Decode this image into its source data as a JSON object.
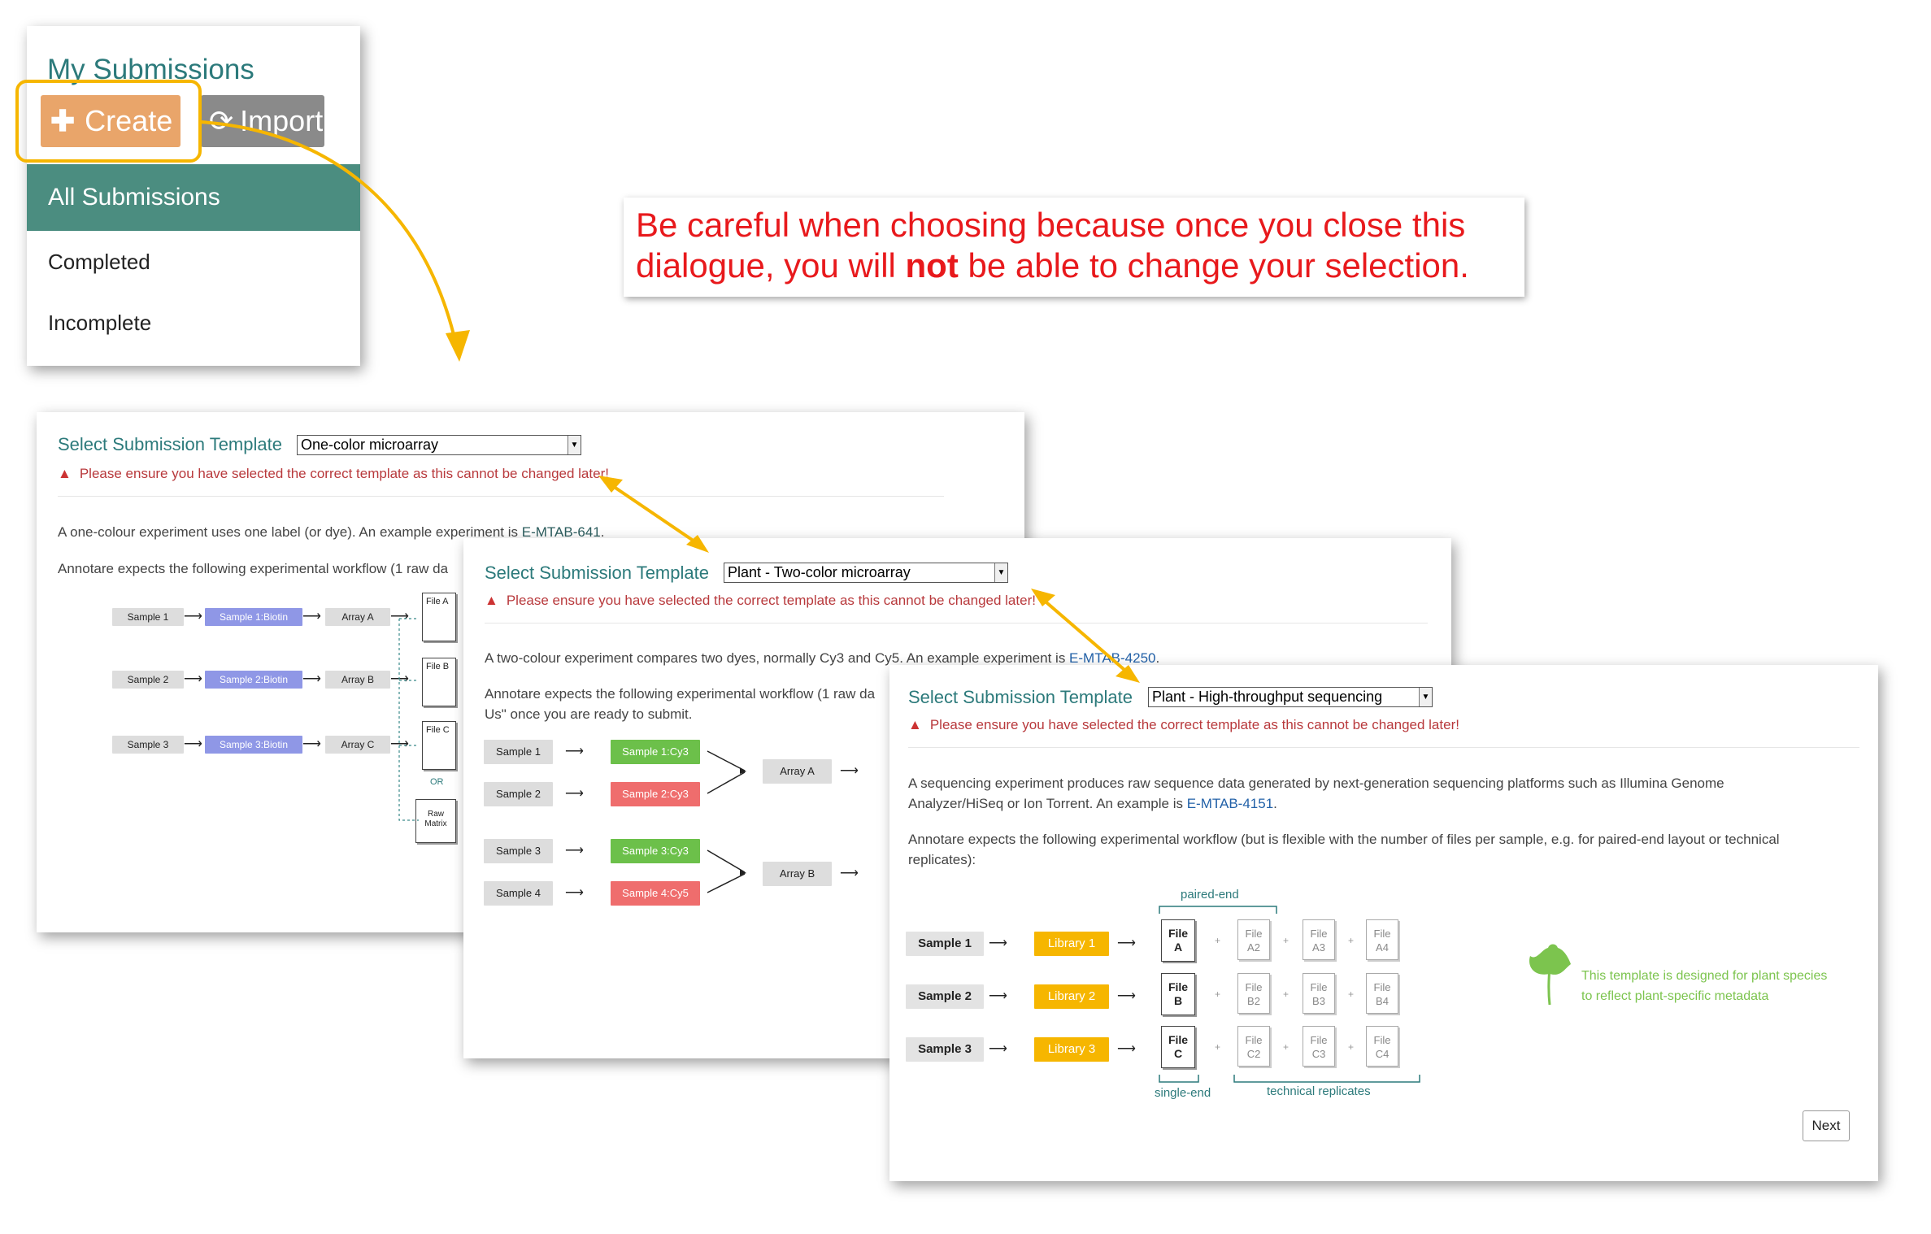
{
  "submissions": {
    "title": "My Submissions",
    "create_label": "Create",
    "import_label": "Import",
    "all_label": "All Submissions",
    "completed_label": "Completed",
    "incomplete_label": "Incomplete"
  },
  "note": {
    "line1": "Be careful when choosing because once you close this",
    "line2_pre": "dialogue,  you will ",
    "line2_bold": "not",
    "line2_post": " be able to change your selection."
  },
  "warning": "Please ensure you have selected the correct template as this cannot be changed later!",
  "template_label": "Select Submission Template",
  "dialog1": {
    "selected": "One-color microarray",
    "desc_pre": "A one-colour experiment uses one label (or dye). An example experiment is ",
    "desc_link": "E-MTAB-641",
    "desc_post": ".",
    "workflow": "Annotare expects the following experimental workflow (1 raw da",
    "samples": [
      "Sample 1",
      "Sample 2",
      "Sample 3"
    ],
    "labels": [
      "Sample 1:Biotin",
      "Sample 2:Biotin",
      "Sample 3:Biotin"
    ],
    "arrays": [
      "Array A",
      "Array B",
      "Array C"
    ],
    "files": [
      "File A",
      "File B",
      "File C"
    ],
    "or": "OR",
    "raw": "Raw Matrix"
  },
  "dialog2": {
    "selected": "Plant - Two-color microarray",
    "desc_pre": "A two-colour experiment compares two dyes, normally Cy3 and Cy5. An example experiment is ",
    "desc_link": "E-MTAB-4250",
    "desc_post": ".",
    "workflow1": "Annotare expects the following experimental workflow (1 raw da",
    "workflow2": "Us\" once you are ready to submit.",
    "samples": [
      "Sample 1",
      "Sample 2",
      "Sample 3",
      "Sample 4"
    ],
    "labels": [
      "Sample 1:Cy3",
      "Sample 2:Cy3",
      "Sample 3:Cy3",
      "Sample 4:Cy5"
    ],
    "arrays": [
      "Array A",
      "Array B"
    ]
  },
  "dialog3": {
    "selected": "Plant - High-throughput sequencing",
    "desc1": "A sequencing experiment produces raw sequence data generated by next-generation sequencing platforms such as Illumina Genome",
    "desc2_pre": "Analyzer/HiSeq or Ion Torrent. An example is ",
    "desc2_link": "E-MTAB-4151",
    "desc2_post": ".",
    "workflow1": "Annotare expects the following experimental workflow (but is flexible with the number of files per sample, e.g. for paired-end layout or technical",
    "workflow2": "replicates):",
    "paired_end": "paired-end",
    "single_end": "single-end",
    "technical": "technical replicates",
    "samples": [
      "Sample 1",
      "Sample 2",
      "Sample 3"
    ],
    "libraries": [
      "Library 1",
      "Library 2",
      "Library 3"
    ],
    "file_word": "File",
    "file_ids": [
      "A",
      "B",
      "C"
    ],
    "rep_ids": [
      [
        "A2",
        "A3",
        "A4"
      ],
      [
        "B2",
        "B3",
        "B4"
      ],
      [
        "C2",
        "C3",
        "C4"
      ]
    ],
    "plus": "+",
    "plant_line1": "This template is designed for plant species",
    "plant_line2": "to reflect plant-specific metadata",
    "next_label": "Next"
  },
  "colors": {
    "teal": "#2c7a7b",
    "create": "#e9a56a",
    "import": "#8a8a8a",
    "all_submissions": "#4b8d80",
    "highlight": "#f6b600",
    "warning": "#b8393c",
    "note": "#e8191c",
    "biotin": "#8f97e6",
    "cy3": "#6cc04a",
    "cy5": "#ef6d6d",
    "library": "#f6b600",
    "plant": "#7cc44e"
  },
  "icons": [
    "plus-icon",
    "import-icon",
    "warning-icon",
    "dropdown-arrow-icon",
    "plant-leaf-icon",
    "file-icon",
    "arrow-icon"
  ]
}
